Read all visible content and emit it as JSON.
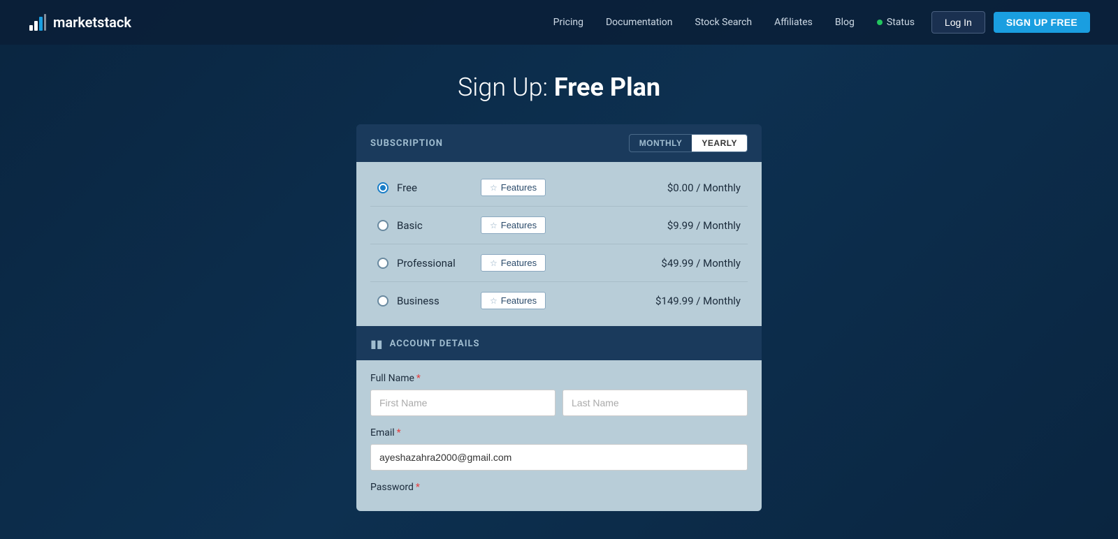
{
  "brand": {
    "name": "marketstack",
    "logo_alt": "marketstack logo"
  },
  "nav": {
    "links": [
      {
        "label": "Pricing",
        "href": "#"
      },
      {
        "label": "Documentation",
        "href": "#"
      },
      {
        "label": "Stock Search",
        "href": "#"
      },
      {
        "label": "Affiliates",
        "href": "#"
      },
      {
        "label": "Blog",
        "href": "#"
      }
    ],
    "status_label": "Status",
    "login_label": "Log In",
    "signup_label": "SIGN UP FREE"
  },
  "page": {
    "title_prefix": "Sign Up: ",
    "title_suffix": "Free Plan"
  },
  "subscription": {
    "section_title": "SUBSCRIPTION",
    "toggle_monthly": "MONTHLY",
    "toggle_yearly": "YEARLY",
    "active_toggle": "monthly",
    "plans": [
      {
        "id": "free",
        "name": "Free",
        "price": "$0.00 / Monthly",
        "selected": true,
        "features_label": "Features"
      },
      {
        "id": "basic",
        "name": "Basic",
        "price": "$9.99 / Monthly",
        "selected": false,
        "features_label": "Features"
      },
      {
        "id": "professional",
        "name": "Professional",
        "price": "$49.99 / Monthly",
        "selected": false,
        "features_label": "Features"
      },
      {
        "id": "business",
        "name": "Business",
        "price": "$149.99 / Monthly",
        "selected": false,
        "features_label": "Features"
      }
    ]
  },
  "account_details": {
    "section_title": "ACCOUNT DETAILS",
    "full_name_label": "Full Name",
    "required_marker": "*",
    "first_name_placeholder": "First Name",
    "last_name_placeholder": "Last Name",
    "email_label": "Email",
    "email_value": "ayeshazahra2000@gmail.com",
    "password_label": "Password"
  }
}
